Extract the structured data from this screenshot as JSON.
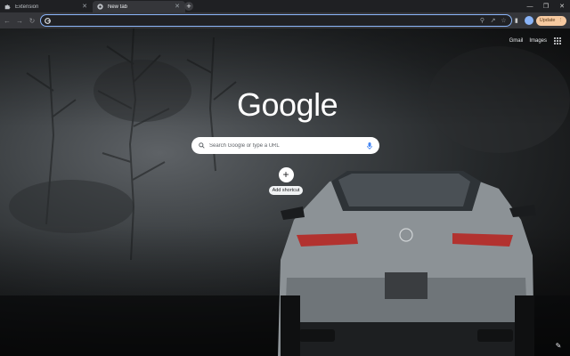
{
  "tabs": [
    {
      "title": "Extension",
      "active": false,
      "favicon": "puzzle-icon"
    },
    {
      "title": "New tab",
      "active": true,
      "favicon": "chrome-icon"
    }
  ],
  "toolbar": {
    "omnibox_value": "",
    "update_label": "Update",
    "accent": "#8ab4f8",
    "update_color": "#f6c9a0"
  },
  "page": {
    "top_links": {
      "gmail": "Gmail",
      "images": "Images"
    },
    "logo": "Google",
    "search_placeholder": "Search Google or type a URL",
    "shortcut_label": "Add shortcut"
  }
}
